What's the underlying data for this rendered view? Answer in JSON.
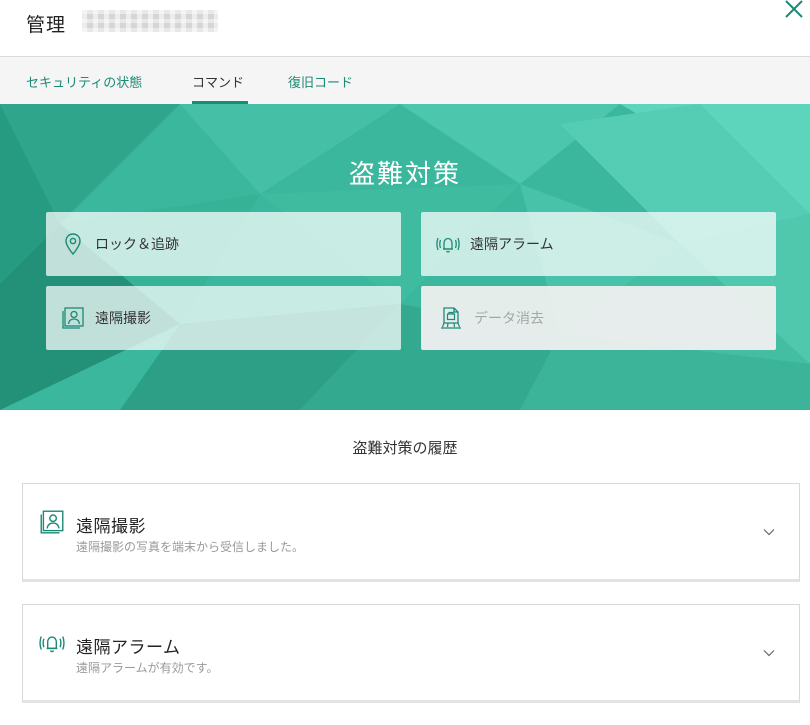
{
  "header": {
    "title": "管理",
    "close_icon": "close-icon"
  },
  "tabs": [
    {
      "label": "セキュリティの状態",
      "active": false
    },
    {
      "label": "コマンド",
      "active": true
    },
    {
      "label": "復旧コード",
      "active": false
    }
  ],
  "hero": {
    "title": "盗難対策",
    "commands": [
      {
        "label": "ロック＆追跡",
        "icon": "map-pin-icon",
        "enabled": true
      },
      {
        "label": "遠隔アラーム",
        "icon": "alarm-bell-icon",
        "enabled": true
      },
      {
        "label": "遠隔撮影",
        "icon": "photo-portrait-icon",
        "enabled": true
      },
      {
        "label": "データ消去",
        "icon": "data-wipe-icon",
        "enabled": false
      }
    ]
  },
  "history": {
    "title": "盗難対策の履歴",
    "items": [
      {
        "title": "遠隔撮影",
        "subtitle": "遠隔撮影の写真を端末から受信しました。",
        "icon": "photo-portrait-icon"
      },
      {
        "title": "遠隔アラーム",
        "subtitle": "遠隔アラームが有効です。",
        "icon": "alarm-bell-icon"
      }
    ]
  },
  "colors": {
    "accent": "#1b8a76",
    "hero_background": "#3ab79c",
    "disabled_text": "#a6a6a6"
  }
}
